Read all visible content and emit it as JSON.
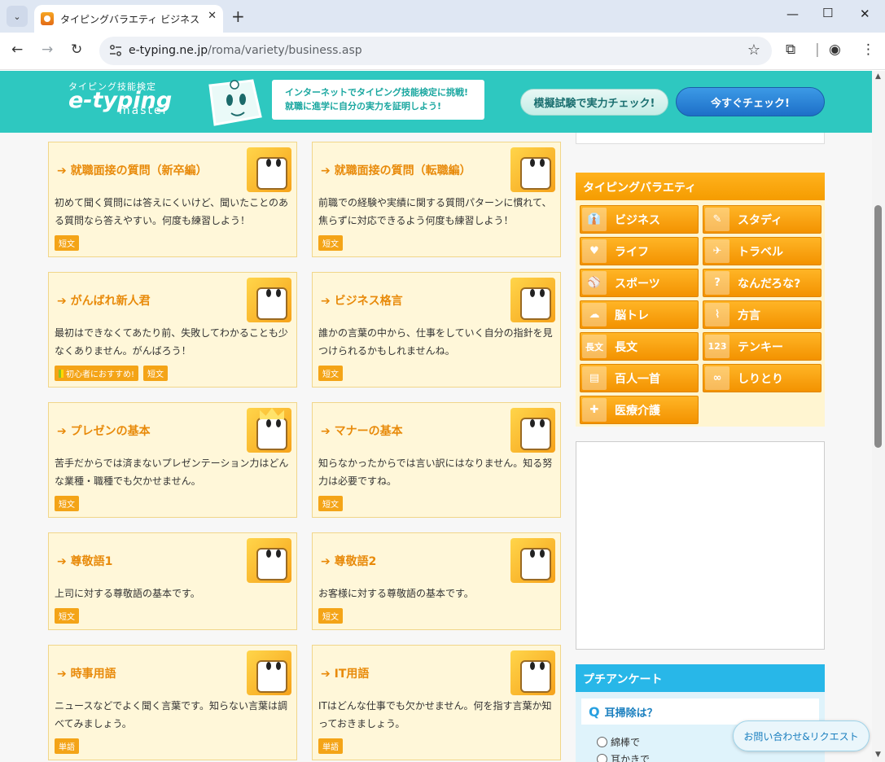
{
  "browser": {
    "tab_title": "タイピングバラエティ ビジネス - インターネット",
    "url_domain": "e-typing.ne.jp",
    "url_path": "/roma/variety/business.asp"
  },
  "header": {
    "logo_small": "タイピング技能検定",
    "logo_big": "e-typing",
    "logo_sub": "master",
    "bubble_line1": "インターネットでタイピング技能検定に挑戦!",
    "bubble_line2": "就職に進学に自分の実力を証明しよう!",
    "mogi_button": "模擬試験で実力チェック!",
    "now_button": "今すぐチェック!"
  },
  "cards": [
    {
      "title": "就職面接の質問（新卒編）",
      "desc": "初めて聞く質問には答えにくいけど、聞いたことのある質問なら答えやすい。何度も練習しよう！",
      "tags": [
        "短文"
      ]
    },
    {
      "title": "就職面接の質問（転職編）",
      "desc": "前職での経験や実績に関する質問パターンに慣れて、焦らずに対応できるよう何度も練習しよう！",
      "tags": [
        "短文"
      ]
    },
    {
      "title": "がんばれ新人君",
      "desc": "最初はできなくてあたり前、失敗してわかることも少なくありません。がんばろう！",
      "tags": [
        "初心者におすすめ!",
        "短文"
      ]
    },
    {
      "title": "ビジネス格言",
      "desc": "誰かの言葉の中から、仕事をしていく自分の指針を見つけられるかもしれませんね。",
      "tags": [
        "短文"
      ]
    },
    {
      "title": "プレゼンの基本",
      "desc": "苦手だからでは済まないプレゼンテーション力はどんな業種・職種でも欠かせません。",
      "tags": [
        "短文"
      ]
    },
    {
      "title": "マナーの基本",
      "desc": "知らなかったからでは言い訳にはなりません。知る努力は必要ですね。",
      "tags": [
        "短文"
      ]
    },
    {
      "title": "尊敬語1",
      "desc": "上司に対する尊敬語の基本です。",
      "tags": [
        "短文"
      ]
    },
    {
      "title": "尊敬語2",
      "desc": "お客様に対する尊敬語の基本です。",
      "tags": [
        "短文"
      ]
    },
    {
      "title": "時事用語",
      "desc": "ニュースなどでよく聞く言葉です。知らない言葉は調べてみましょう。",
      "tags": [
        "単語"
      ]
    },
    {
      "title": "IT用語",
      "desc": "ITはどんな仕事でも欠かせません。何を指す言葉か知っておきましょう。",
      "tags": [
        "単語"
      ]
    }
  ],
  "variety": {
    "heading": "タイピングバラエティ",
    "items": [
      {
        "label": "ビジネス",
        "icon": "tie-icon",
        "glyph": "👔"
      },
      {
        "label": "スタディ",
        "icon": "pencil-icon",
        "glyph": "✎"
      },
      {
        "label": "ライフ",
        "icon": "heart-icon",
        "glyph": "♥"
      },
      {
        "label": "トラベル",
        "icon": "airplane-icon",
        "glyph": "✈"
      },
      {
        "label": "スポーツ",
        "icon": "ball-icon",
        "glyph": "⚾"
      },
      {
        "label": "なんだろな?",
        "icon": "question-icon",
        "glyph": "?"
      },
      {
        "label": "脳トレ",
        "icon": "brain-icon",
        "glyph": "☁"
      },
      {
        "label": "方言",
        "icon": "japan-map-icon",
        "glyph": "⌇"
      },
      {
        "label": "長文",
        "icon": "long-text-icon",
        "glyph": "長文"
      },
      {
        "label": "テンキー",
        "icon": "numbers-icon",
        "glyph": "123"
      },
      {
        "label": "百人一首",
        "icon": "card-icon",
        "glyph": "▤"
      },
      {
        "label": "しりとり",
        "icon": "shiritori-icon",
        "glyph": "∞"
      },
      {
        "label": "医療介護",
        "icon": "syringe-icon",
        "glyph": "✚"
      }
    ]
  },
  "poll": {
    "heading": "プチアンケート",
    "q_mark": "Q",
    "question": "耳掃除は？",
    "options": [
      "綿棒で",
      "耳かきで"
    ]
  },
  "contact": "お問い合わせ&リクエスト"
}
